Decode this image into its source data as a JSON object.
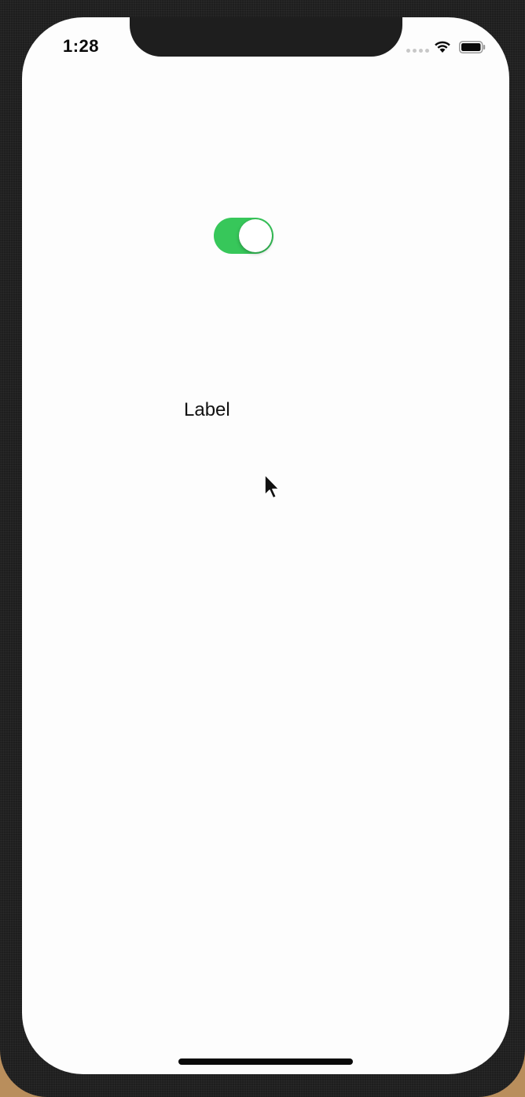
{
  "status_bar": {
    "time": "1:28",
    "signal_icon": "cellular-dots-icon",
    "wifi_icon": "wifi-icon",
    "battery_icon": "battery-icon"
  },
  "content": {
    "switch": {
      "state": "on",
      "on_color": "#37c75a"
    },
    "label_text": "Label"
  },
  "pointer": {
    "icon": "mouse-cursor-icon"
  },
  "colors": {
    "screen_background": "#fdfdfd",
    "frame": "#1e1e1e"
  }
}
